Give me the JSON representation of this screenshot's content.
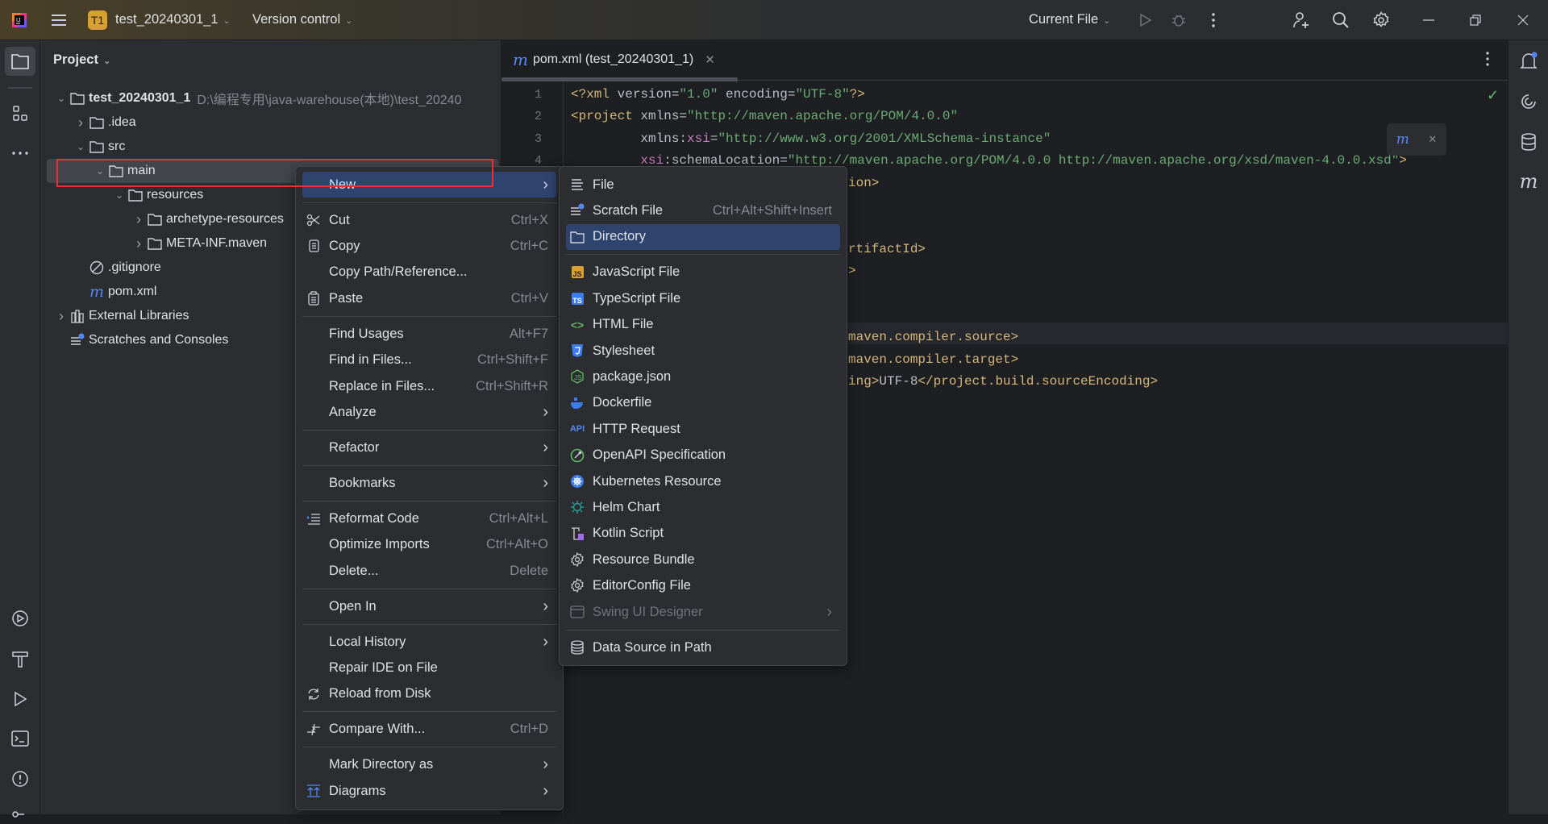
{
  "titlebar": {
    "project_badge": "T1",
    "project_name": "test_20240301_1",
    "vcs": "Version control",
    "run_config": "Current File",
    "badge_color": "#d9a02f"
  },
  "project_panel": {
    "title": "Project",
    "tree": [
      {
        "label": "test_20240301_1",
        "path": "D:\\编程专用\\java-warehouse(本地)\\test_20240",
        "level": 0,
        "arrow": "expanded",
        "icon": "module-folder-icon"
      },
      {
        "label": ".idea",
        "level": 1,
        "arrow": "collapsed",
        "icon": "folder-icon"
      },
      {
        "label": "src",
        "level": 1,
        "arrow": "expanded",
        "icon": "folder-icon"
      },
      {
        "label": "main",
        "level": 2,
        "arrow": "expanded",
        "icon": "folder-icon",
        "selected": true
      },
      {
        "label": "resources",
        "level": 3,
        "arrow": "expanded",
        "icon": "resources-folder-icon"
      },
      {
        "label": "archetype-resources",
        "level": 4,
        "arrow": "collapsed",
        "icon": "excluded-folder-icon"
      },
      {
        "label": "META-INF.maven",
        "level": 4,
        "arrow": "collapsed",
        "icon": "folder-icon"
      },
      {
        "label": ".gitignore",
        "level": 1,
        "arrow": "none",
        "icon": "ignore-icon"
      },
      {
        "label": "pom.xml",
        "level": 1,
        "arrow": "none",
        "icon": "maven-icon"
      },
      {
        "label": "External Libraries",
        "level": 0,
        "arrow": "collapsed",
        "icon": "library-icon"
      },
      {
        "label": "Scratches and Consoles",
        "level": 0,
        "arrow": "none",
        "icon": "scratches-icon"
      }
    ]
  },
  "editor": {
    "tab_label": "pom.xml (test_20240301_1)",
    "lines": [
      {
        "n": "1",
        "parts": [
          [
            "t",
            "<?xml "
          ],
          [
            "a",
            "version="
          ],
          [
            "s",
            "\"1.0\""
          ],
          [
            "a",
            " encoding="
          ],
          [
            "s",
            "\"UTF-8\""
          ],
          [
            "t",
            "?>"
          ]
        ]
      },
      {
        "n": "2",
        "parts": [
          [
            "t",
            "<project "
          ],
          [
            "a",
            "xmlns="
          ],
          [
            "s",
            "\"http://maven.apache.org/POM/4.0.0\""
          ]
        ]
      },
      {
        "n": "3",
        "parts": [
          [
            "a",
            "         xmlns:"
          ],
          [
            "ns",
            "xsi"
          ],
          [
            "a",
            "="
          ],
          [
            "s",
            "\"http://www.w3.org/2001/XMLSchema-instance\""
          ]
        ]
      },
      {
        "n": "4",
        "parts": [
          [
            "ns",
            "         xsi"
          ],
          [
            "a",
            ":schemaLocation="
          ],
          [
            "s",
            "\"http://maven.apache.org/POM/4.0.0 http://maven.apache.org/xsd/maven-4.0.0.xsd\""
          ],
          [
            "t",
            ">"
          ]
        ]
      }
    ],
    "fragments": [
      {
        "line": 5,
        "parts": [
          [
            "t",
            "ion>"
          ]
        ]
      },
      {
        "line": 8,
        "parts": [
          [
            "t",
            "rtifactId>"
          ]
        ]
      },
      {
        "line": 9,
        "parts": [
          [
            "t",
            ">"
          ]
        ]
      },
      {
        "line": 12,
        "parts": [
          [
            "t",
            "maven.compiler.source>"
          ]
        ]
      },
      {
        "line": 13,
        "parts": [
          [
            "t",
            "maven.compiler.target>"
          ]
        ]
      },
      {
        "line": 14,
        "parts": [
          [
            "t",
            "ing>"
          ],
          [
            "a",
            "UTF-8"
          ],
          [
            "t",
            "</project.build.sourceEncoding>"
          ]
        ]
      }
    ]
  },
  "context_menu": {
    "items": [
      {
        "label": "New",
        "submenu": true,
        "highlighted": true
      },
      {
        "sep": true
      },
      {
        "label": "Cut",
        "shortcut": "Ctrl+X",
        "icon": "scissors-icon"
      },
      {
        "label": "Copy",
        "shortcut": "Ctrl+C",
        "icon": "copy-icon"
      },
      {
        "label": "Copy Path/Reference..."
      },
      {
        "label": "Paste",
        "shortcut": "Ctrl+V",
        "icon": "paste-icon"
      },
      {
        "sep": true
      },
      {
        "label": "Find Usages",
        "shortcut": "Alt+F7"
      },
      {
        "label": "Find in Files...",
        "shortcut": "Ctrl+Shift+F"
      },
      {
        "label": "Replace in Files...",
        "shortcut": "Ctrl+Shift+R"
      },
      {
        "label": "Analyze",
        "submenu": true
      },
      {
        "sep": true
      },
      {
        "label": "Refactor",
        "submenu": true
      },
      {
        "sep": true
      },
      {
        "label": "Bookmarks",
        "submenu": true
      },
      {
        "sep": true
      },
      {
        "label": "Reformat Code",
        "shortcut": "Ctrl+Alt+L",
        "icon": "reformat-icon"
      },
      {
        "label": "Optimize Imports",
        "shortcut": "Ctrl+Alt+O"
      },
      {
        "label": "Delete...",
        "shortcut": "Delete"
      },
      {
        "sep": true
      },
      {
        "label": "Open In",
        "submenu": true
      },
      {
        "sep": true
      },
      {
        "label": "Local History",
        "submenu": true
      },
      {
        "label": "Repair IDE on File"
      },
      {
        "label": "Reload from Disk",
        "icon": "reload-icon"
      },
      {
        "sep": true
      },
      {
        "label": "Compare With...",
        "shortcut": "Ctrl+D",
        "icon": "compare-icon"
      },
      {
        "sep": true
      },
      {
        "label": "Mark Directory as",
        "submenu": true
      },
      {
        "label": "Diagrams",
        "submenu": true,
        "icon": "diagram-icon"
      }
    ]
  },
  "new_submenu": {
    "items": [
      {
        "label": "File",
        "icon": "file-icon"
      },
      {
        "label": "Scratch File",
        "shortcut": "Ctrl+Alt+Shift+Insert",
        "icon": "scratch-icon"
      },
      {
        "label": "Directory",
        "icon": "folder-icon",
        "highlighted": true
      },
      {
        "sep": true
      },
      {
        "label": "JavaScript File",
        "icon": "javascript-icon"
      },
      {
        "label": "TypeScript File",
        "icon": "typescript-icon"
      },
      {
        "label": "HTML File",
        "icon": "html-icon"
      },
      {
        "label": "Stylesheet",
        "icon": "css-icon"
      },
      {
        "label": "package.json",
        "icon": "nodejs-icon"
      },
      {
        "label": "Dockerfile",
        "icon": "docker-icon"
      },
      {
        "label": "HTTP Request",
        "icon": "api-icon"
      },
      {
        "label": "OpenAPI Specification",
        "icon": "openapi-icon"
      },
      {
        "label": "Kubernetes Resource",
        "icon": "kubernetes-icon"
      },
      {
        "label": "Helm Chart",
        "icon": "helm-icon"
      },
      {
        "label": "Kotlin Script",
        "icon": "kotlin-script-icon"
      },
      {
        "label": "Resource Bundle",
        "icon": "gear-icon"
      },
      {
        "label": "EditorConfig File",
        "icon": "gear-icon"
      },
      {
        "label": "Swing UI Designer",
        "icon": "form-icon",
        "submenu": true,
        "disabled": true
      },
      {
        "sep": true
      },
      {
        "label": "Data Source in Path",
        "icon": "database-icon"
      }
    ]
  }
}
